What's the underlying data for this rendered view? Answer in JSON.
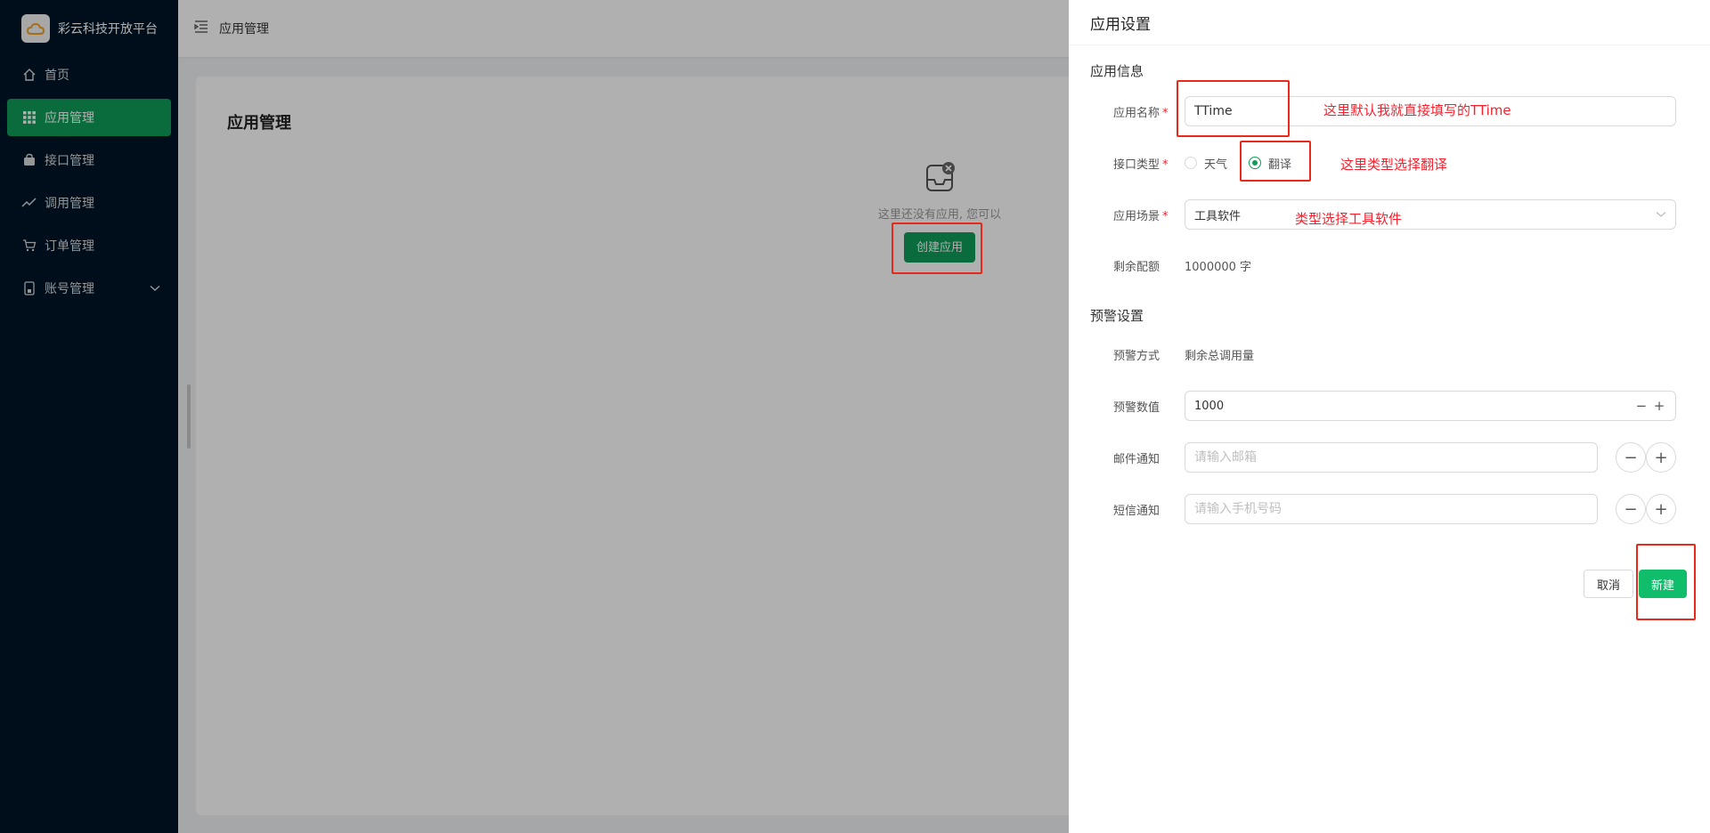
{
  "brand": {
    "name": "彩云科技开放平台"
  },
  "sidebar": {
    "items": [
      {
        "label": "首页",
        "icon": "home-icon"
      },
      {
        "label": "应用管理",
        "icon": "grid-icon",
        "active": true
      },
      {
        "label": "接口管理",
        "icon": "bag-icon"
      },
      {
        "label": "调用管理",
        "icon": "trend-icon"
      },
      {
        "label": "订单管理",
        "icon": "cart-icon"
      },
      {
        "label": "账号管理",
        "icon": "phone-icon",
        "expandable": true
      }
    ]
  },
  "header": {
    "breadcrumb": "应用管理"
  },
  "main": {
    "title": "应用管理",
    "empty_tip": "这里还没有应用, 您可以",
    "create_button": "创建应用"
  },
  "drawer": {
    "title": "应用设置",
    "app_info": {
      "section": "应用信息",
      "name_label": "应用名称",
      "name_value": "TTime",
      "type_label": "接口类型",
      "type_options": [
        "天气",
        "翻译"
      ],
      "type_selected": "翻译",
      "scene_label": "应用场景",
      "scene_value": "工具软件",
      "quota_label": "剩余配额",
      "quota_value": "1000000 字"
    },
    "alert": {
      "section": "预警设置",
      "mode_label": "预警方式",
      "mode_value": "剩余总调用量",
      "threshold_label": "预警数值",
      "threshold_value": "1000",
      "email_label": "邮件通知",
      "email_placeholder": "请输入邮箱",
      "sms_label": "短信通知",
      "sms_placeholder": "请输入手机号码"
    },
    "cancel": "取消",
    "submit": "新建"
  },
  "annotations": {
    "name_note": "这里默认我就直接填写的TTime",
    "type_note": "这里类型选择翻译",
    "scene_note": "类型选择工具软件"
  },
  "colors": {
    "primary": "#0f9d58",
    "sidebar_bg": "#001529",
    "annotation": "#f5222d"
  }
}
